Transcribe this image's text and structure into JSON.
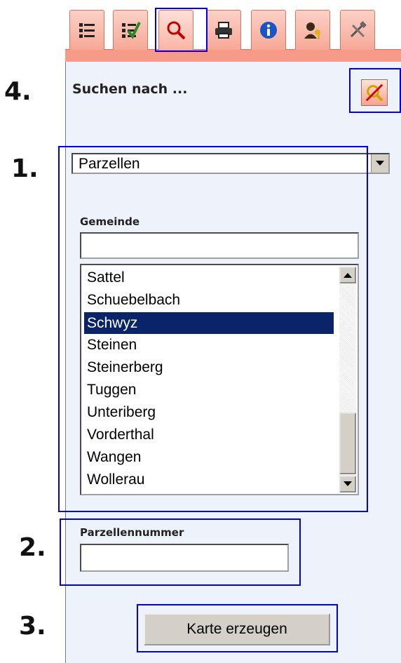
{
  "tabs": [
    {
      "name": "legend-icon"
    },
    {
      "name": "layer-check-icon"
    },
    {
      "name": "search-icon"
    },
    {
      "name": "print-icon"
    },
    {
      "name": "info-icon"
    },
    {
      "name": "user-key-icon"
    },
    {
      "name": "tools-icon"
    }
  ],
  "annotations": {
    "n4": "4.",
    "n1": "1.",
    "n2": "2.",
    "n3": "3."
  },
  "search": {
    "title": "Suchen nach ...",
    "type_select": "Parzellen",
    "gemeinde_label": "Gemeinde",
    "gemeinde_value": "",
    "gemeinde_list": [
      "Sattel",
      "Schuebelbach",
      "Schwyz",
      "Steinen",
      "Steinerberg",
      "Tuggen",
      "Unteriberg",
      "Vorderthal",
      "Wangen",
      "Wollerau"
    ],
    "gemeinde_selected": "Schwyz",
    "parzelle_label": "Parzellennummer",
    "parzelle_value": "",
    "submit_label": "Karte erzeugen"
  },
  "colors": {
    "highlight": "#0000e0",
    "selection": "#0a246a",
    "tab": "#f7a896"
  }
}
